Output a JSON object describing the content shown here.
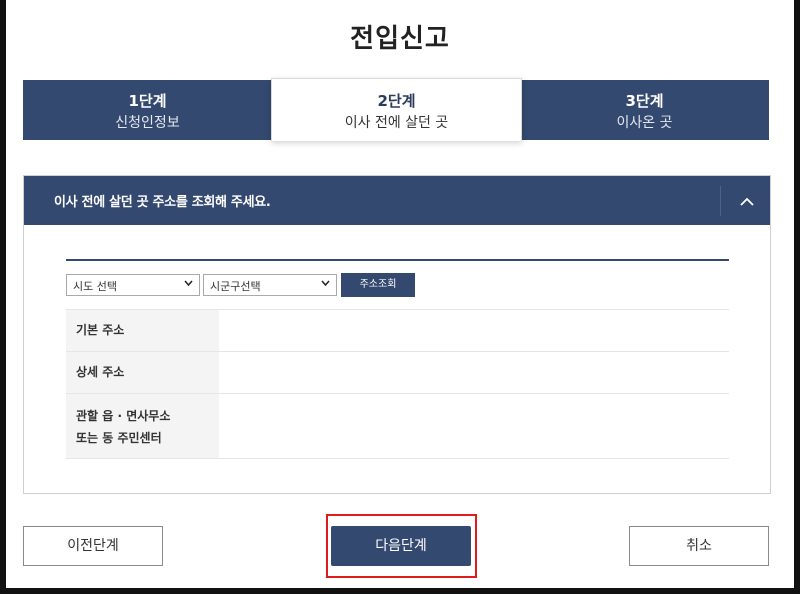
{
  "page_title": "전입신고",
  "steps": [
    {
      "num": "1단계",
      "name": "신청인정보"
    },
    {
      "num": "2단계",
      "name": "이사 전에 살던 곳"
    },
    {
      "num": "3단계",
      "name": "이사온 곳"
    }
  ],
  "active_step": 2,
  "panel": {
    "heading": "이사 전에 살던 곳 주소를 조회해 주세요.",
    "sido_select": {
      "value": "시도 선택"
    },
    "sigungu_select": {
      "value": "시군구선택"
    },
    "lookup_button": "주소조회",
    "rows": [
      {
        "label": "기본 주소",
        "value": ""
      },
      {
        "label": "상세 주소",
        "value": ""
      },
      {
        "label_line1": "관할 읍 · 면사무소",
        "label_line2": "또는 동 주민센터",
        "value": ""
      }
    ]
  },
  "buttons": {
    "prev": "이전단계",
    "next": "다음단계",
    "cancel": "취소"
  },
  "colors": {
    "primary": "#34496f",
    "highlight": "#e01b1b"
  }
}
